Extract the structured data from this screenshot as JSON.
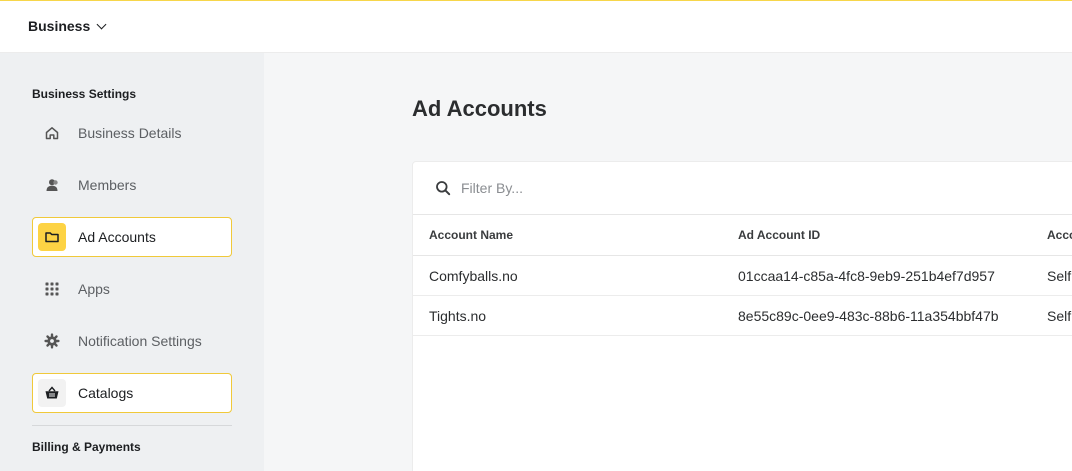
{
  "header": {
    "business_label": "Business"
  },
  "sidebar": {
    "section_business_settings": "Business Settings",
    "items": [
      {
        "label": "Business Details",
        "icon": "home-icon"
      },
      {
        "label": "Members",
        "icon": "member-icon"
      },
      {
        "label": "Ad Accounts",
        "icon": "folder-icon",
        "selected": true
      },
      {
        "label": "Apps",
        "icon": "grid-icon"
      },
      {
        "label": "Notification Settings",
        "icon": "gear-icon"
      },
      {
        "label": "Catalogs",
        "icon": "basket-icon",
        "highlighted": true
      }
    ],
    "section_billing": "Billing & Payments"
  },
  "main": {
    "title": "Ad Accounts",
    "filter_placeholder": "Filter By...",
    "table": {
      "columns": [
        "Account Name",
        "Ad Account ID",
        "Acco"
      ],
      "rows": [
        [
          "Comfyballs.no",
          "01ccaa14-c85a-4fc8-9eb9-251b4ef7d957",
          "Self"
        ],
        [
          "Tights.no",
          "8e55c89c-0ee9-483c-88b6-11a354bbf47b",
          "Self"
        ]
      ]
    }
  },
  "colors": {
    "accent": "#fdd344",
    "highlight_border": "#f0c93a",
    "sidebar_bg": "#eef0f2",
    "page_bg": "#f5f6f7"
  }
}
